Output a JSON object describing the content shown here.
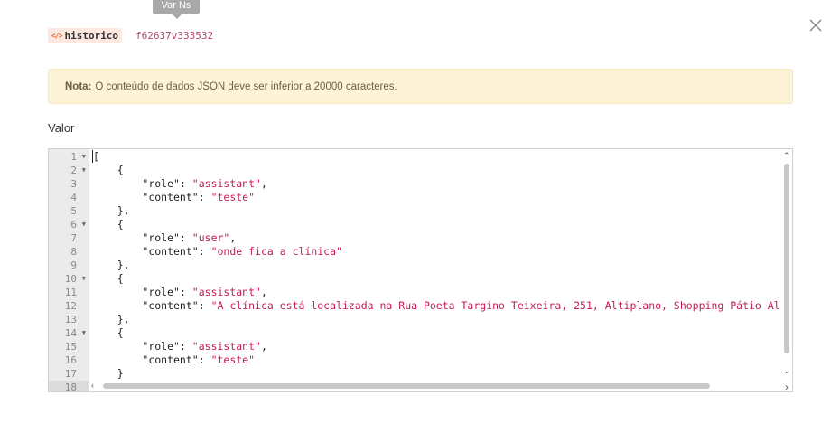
{
  "tooltip": {
    "text": "Var Ns"
  },
  "variable": {
    "name": "historico",
    "id": "f62637v333532"
  },
  "note": {
    "label": "Nota:",
    "text": "O conteúdo de dados JSON deve ser inferior a 20000 caracteres."
  },
  "field": {
    "label": "Valor"
  },
  "editor": {
    "line_numbers": [
      "1",
      "2",
      "3",
      "4",
      "5",
      "6",
      "7",
      "8",
      "9",
      "10",
      "11",
      "12",
      "13",
      "14",
      "15",
      "16",
      "17",
      "18"
    ],
    "fold_lines": [
      1,
      2,
      6,
      10,
      14
    ],
    "lines": [
      "[",
      "    {",
      "        \"role\": \"assistant\",",
      "        \"content\": \"teste\"",
      "    },",
      "    {",
      "        \"role\": \"user\",",
      "        \"content\": \"onde fica a clínica\"",
      "    },",
      "    {",
      "        \"role\": \"assistant\",",
      "        \"content\": \"A clínica está localizada na Rua Poeta Targino Teixeira, 251, Altiplano, Shopping Pátio Al",
      "    },",
      "    {",
      "        \"role\": \"assistant\",",
      "        \"content\": \"teste\"",
      "    }",
      ""
    ]
  }
}
